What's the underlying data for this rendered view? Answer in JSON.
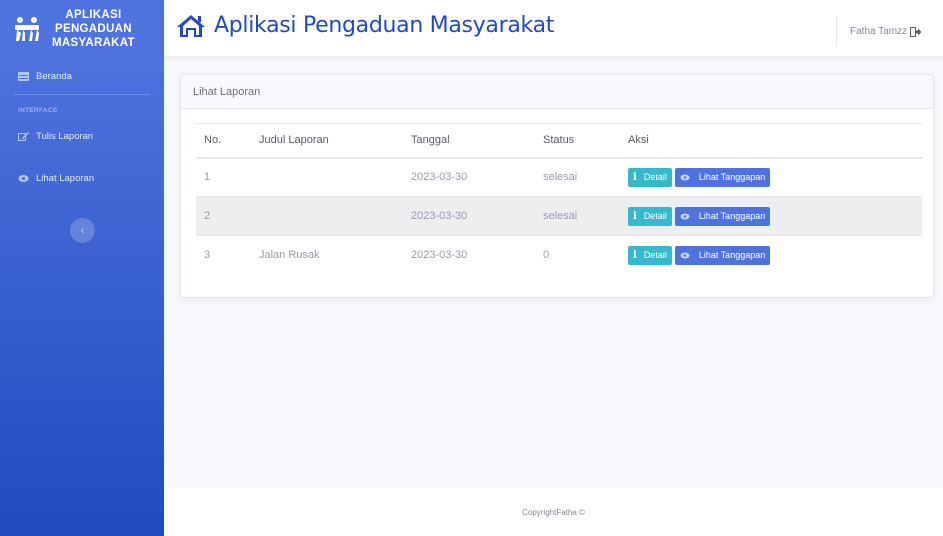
{
  "sidebar": {
    "brand_line1": "APLIKASI",
    "brand_line2": "PENGADUAN",
    "brand_line3": "MASYARAKAT",
    "items": [
      {
        "label": "Beranda",
        "icon": "table-icon"
      },
      {
        "label": "Tulis Laporan",
        "icon": "edit-icon"
      },
      {
        "label": "Lihat Laporan",
        "icon": "eye-icon"
      }
    ],
    "heading": "INTERFACE",
    "toggle_symbol": "‹"
  },
  "topbar": {
    "title": "Aplikasi Pengaduan Masyarakat",
    "user_name": "Fatha Tamzz"
  },
  "card": {
    "header": "Lihat Laporan",
    "columns": [
      "No.",
      "Judul Laporan",
      "Tanggal",
      "Status",
      "Aksi"
    ],
    "rows": [
      {
        "no": "1",
        "judul": "",
        "tanggal": "2023-03-30",
        "status": "selesai"
      },
      {
        "no": "2",
        "judul": "",
        "tanggal": "2023-03-30",
        "status": "selesai"
      },
      {
        "no": "3",
        "judul": "Jalan Rusak",
        "tanggal": "2023-03-30",
        "status": "0"
      }
    ],
    "detail_label": "Detail",
    "tanggapan_label": "Lihat Tanggapan"
  },
  "footer": {
    "text": "CopyrightFatha ©"
  },
  "colors": {
    "primary": "#4e73df",
    "info": "#36b9cc",
    "sidebar_dark": "#224abe"
  }
}
